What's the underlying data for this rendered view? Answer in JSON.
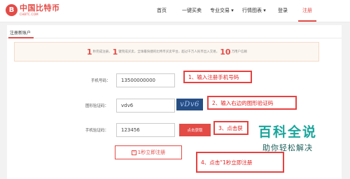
{
  "header": {
    "logo_mark": "B",
    "logo_name": "中国比特币",
    "logo_domain": "CHBTC.COM",
    "nav": [
      "首页",
      "一键买卖",
      "专业交易 ▾",
      "行情图表 ▾",
      "登录",
      "注册"
    ],
    "active_nav": "注册"
  },
  "tabs": {
    "active": "注册新账户"
  },
  "notice": {
    "n1": "1",
    "t1": "秒完成注册，",
    "n2": "1",
    "t2": "键完成买卖，全球最快捷的比特币买卖平台，超过",
    "t3": "千万人民币出入交易，",
    "n3": "10",
    "t4": "万用户信赖"
  },
  "form": {
    "phone": {
      "label": "手机号码：",
      "value": "13500000000"
    },
    "captcha": {
      "label": "图形验证码：",
      "value": "vdv6",
      "image_text": "vDv6"
    },
    "sms": {
      "label": "手机验证码：",
      "value": "123456",
      "button": "点击获取"
    },
    "submit": {
      "icon": "↑",
      "label": "1秒立即注册"
    }
  },
  "annotations": {
    "a1": "1、输入注册手机号码",
    "a2": "2、输入右边的图形验证码",
    "a3": "3、点击获",
    "a4": "4、点击“1秒立即注册"
  },
  "watermark": {
    "title": "百科全说",
    "subtitle": "助你轻松解决"
  },
  "colors": {
    "accent": "#e34b46",
    "annotation": "#e84040",
    "watermark": "#1aa59c"
  }
}
